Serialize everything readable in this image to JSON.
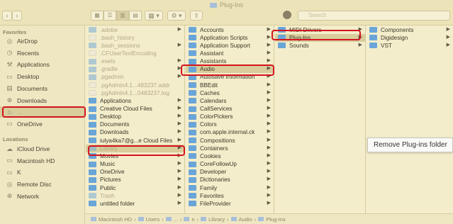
{
  "window": {
    "title": "Plug-Ins"
  },
  "toolbar": {
    "back": "‹",
    "forward": "›",
    "views": [
      "▦",
      "☰",
      "▥",
      "▤"
    ],
    "group": "▦ ▾",
    "action": "⚙ ▾",
    "share": "⇪",
    "search_placeholder": "Search"
  },
  "sidebar": {
    "favorites_header": "Favorites",
    "favorites": [
      {
        "label": "AirDrop",
        "icon": "airdrop-icon",
        "glyph": "◎"
      },
      {
        "label": "Recents",
        "icon": "clock-icon",
        "glyph": "◷"
      },
      {
        "label": "Applications",
        "icon": "applications-icon",
        "glyph": "⚒"
      },
      {
        "label": "Desktop",
        "icon": "desktop-icon",
        "glyph": "▭"
      },
      {
        "label": "Documents",
        "icon": "documents-icon",
        "glyph": "▤"
      },
      {
        "label": "Downloads",
        "icon": "downloads-icon",
        "glyph": "⊕"
      },
      {
        "label": "... ",
        "icon": "home-icon",
        "glyph": "⌂"
      },
      {
        "label": "OneDrive",
        "icon": "folder-icon",
        "glyph": "▭"
      }
    ],
    "locations_header": "Locations",
    "locations": [
      {
        "label": "iCloud Drive",
        "icon": "cloud-icon",
        "glyph": "☁"
      },
      {
        "label": "Macintosh HD",
        "icon": "disk-icon",
        "glyph": "▭"
      },
      {
        "label": "K",
        "icon": "disk-icon",
        "glyph": "▭"
      },
      {
        "label": "Remote Disc",
        "icon": "disc-icon",
        "glyph": "◎"
      },
      {
        "label": "Network",
        "icon": "network-icon",
        "glyph": "⊕"
      }
    ]
  },
  "columns": [
    [
      {
        "label": ".adobe",
        "type": "folder",
        "dim": true,
        "chevron": true
      },
      {
        "label": ".bash_history",
        "type": "doc",
        "dim": true
      },
      {
        "label": ".bash_sessions",
        "type": "folder",
        "dim": true,
        "chevron": true
      },
      {
        "label": ".CFUserTextEncoding",
        "type": "doc",
        "dim": true
      },
      {
        "label": ".esets",
        "type": "folder",
        "dim": true,
        "chevron": true
      },
      {
        "label": ".gradle",
        "type": "folder",
        "dim": true,
        "chevron": true
      },
      {
        "label": ".pgadmin",
        "type": "folder",
        "dim": true,
        "chevron": true
      },
      {
        "label": ".pgAdmin4.1...483237.addr",
        "type": "doc",
        "dim": true
      },
      {
        "label": ".pgAdmin4.1...0483237.log",
        "type": "doc",
        "dim": true
      },
      {
        "label": "Applications",
        "type": "folder",
        "chevron": true
      },
      {
        "label": "Creative Cloud Files",
        "type": "folder",
        "chevron": true
      },
      {
        "label": "Desktop",
        "type": "folder",
        "chevron": true
      },
      {
        "label": "Documents",
        "type": "folder",
        "chevron": true
      },
      {
        "label": "Downloads",
        "type": "folder",
        "chevron": true
      },
      {
        "label": "iulya4ka7@g...e Cloud Files",
        "type": "folder",
        "chevron": true
      },
      {
        "label": "Library",
        "type": "folder",
        "dim": true,
        "selected": true,
        "chevron": true
      },
      {
        "label": "Movies",
        "type": "folder",
        "chevron": true
      },
      {
        "label": "Music",
        "type": "folder",
        "chevron": true
      },
      {
        "label": "OneDrive",
        "type": "folder",
        "chevron": true
      },
      {
        "label": "Pictures",
        "type": "folder",
        "chevron": true
      },
      {
        "label": "Public",
        "type": "folder",
        "chevron": true
      },
      {
        "label": "Trash",
        "type": "folder",
        "dim": true,
        "chevron": true
      },
      {
        "label": "untitled folder",
        "type": "folder",
        "chevron": true
      }
    ],
    [
      {
        "label": "Accounts",
        "type": "folder",
        "chevron": true
      },
      {
        "label": "Application Scripts",
        "type": "folder",
        "chevron": true
      },
      {
        "label": "Application Support",
        "type": "folder",
        "chevron": true
      },
      {
        "label": "Assistant",
        "type": "folder",
        "chevron": true
      },
      {
        "label": "Assistants",
        "type": "folder",
        "chevron": true
      },
      {
        "label": "Audio",
        "type": "folder",
        "selected": true,
        "chevron": true
      },
      {
        "label": "Autosave Information",
        "type": "folder",
        "chevron": true
      },
      {
        "label": "BBEdit",
        "type": "folder",
        "chevron": true
      },
      {
        "label": "Caches",
        "type": "folder",
        "chevron": true
      },
      {
        "label": "Calendars",
        "type": "folder",
        "chevron": true
      },
      {
        "label": "CallServices",
        "type": "folder",
        "chevron": true
      },
      {
        "label": "ColorPickers",
        "type": "folder",
        "chevron": true
      },
      {
        "label": "Colors",
        "type": "folder",
        "chevron": true
      },
      {
        "label": "com.apple.internal.ck",
        "type": "folder",
        "chevron": true
      },
      {
        "label": "Compositions",
        "type": "folder",
        "chevron": true
      },
      {
        "label": "Containers",
        "type": "folder",
        "chevron": true
      },
      {
        "label": "Cookies",
        "type": "folder",
        "chevron": true
      },
      {
        "label": "CoreFollowUp",
        "type": "folder",
        "chevron": true
      },
      {
        "label": "Developer",
        "type": "folder",
        "chevron": true
      },
      {
        "label": "Dictionaries",
        "type": "folder",
        "chevron": true
      },
      {
        "label": "Family",
        "type": "folder",
        "chevron": true
      },
      {
        "label": "Favorites",
        "type": "folder",
        "chevron": true
      },
      {
        "label": "FileProvider",
        "type": "folder",
        "chevron": true
      }
    ],
    [
      {
        "label": "MIDI Drivers",
        "type": "folder",
        "chevron": true
      },
      {
        "label": "Plug-Ins",
        "type": "folder",
        "selected": true,
        "chevron": true
      },
      {
        "label": "Sounds",
        "type": "folder",
        "chevron": true
      }
    ],
    [
      {
        "label": "Components",
        "type": "folder",
        "chevron": true
      },
      {
        "label": "Digidesign",
        "type": "folder",
        "chevron": true
      },
      {
        "label": "VST",
        "type": "folder",
        "chevron": true
      }
    ]
  ],
  "path_bar": [
    "Macintosh HD",
    "Users",
    "...",
    "n",
    "Library",
    "Audio",
    "Plug-Ins"
  ],
  "tooltip": "Remove Plug-ins folder"
}
